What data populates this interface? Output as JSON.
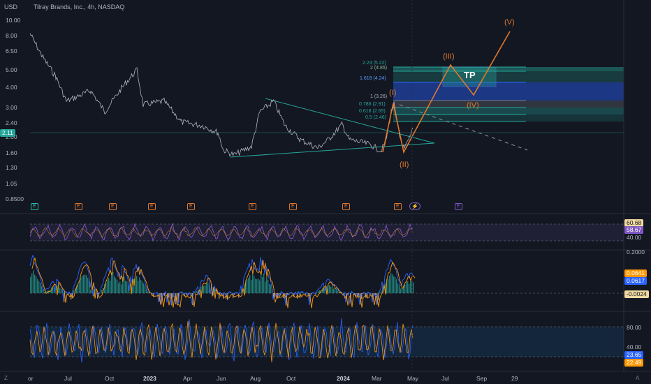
{
  "header": {
    "currency": "USD",
    "symbol": "Tilray Brands, Inc., 4h, NASDAQ"
  },
  "price_axis": [
    "10.00",
    "8.00",
    "6.50",
    "5.00",
    "4.00",
    "3.00",
    "2.40",
    "2.00",
    "1.60",
    "1.30",
    "1.05",
    "0.8500"
  ],
  "current_price": "2.11",
  "x_axis": [
    {
      "label": "or",
      "bold": false
    },
    {
      "label": "Jul",
      "bold": false
    },
    {
      "label": "Oct",
      "bold": false
    },
    {
      "label": "2023",
      "bold": true
    },
    {
      "label": "Apr",
      "bold": false
    },
    {
      "label": "Jun",
      "bold": false
    },
    {
      "label": "Aug",
      "bold": false
    },
    {
      "label": "Oct",
      "bold": false
    },
    {
      "label": "2024",
      "bold": true
    },
    {
      "label": "Mar",
      "bold": false
    },
    {
      "label": "May",
      "bold": false
    },
    {
      "label": "Jul",
      "bold": false
    },
    {
      "label": "Sep",
      "bold": false
    },
    {
      "label": "29",
      "bold": false
    }
  ],
  "waves": [
    "(I)",
    "(II)",
    "(III)",
    "(IV)",
    "(V)"
  ],
  "target_label": "TP",
  "fib_levels": [
    "2.23 (5.22)",
    "2 (4.85)",
    "1.618 (4.24)",
    "1 (3.26)",
    "0.786 (2.91)",
    "0.618 (2.65)",
    "0.5 (2.46)"
  ],
  "earnings_marker": "E",
  "dividend_marker": "⚡",
  "rsi": {
    "values": [
      "60.68",
      "58.67"
    ],
    "scale": [
      "40.00"
    ]
  },
  "macd": {
    "values": [
      "0.0641",
      "0.0617",
      "-0.0024"
    ],
    "scale": [
      "0.2000"
    ]
  },
  "stoch": {
    "values": [
      "23.65",
      "22.49"
    ],
    "scale": [
      "80.00",
      "40.00"
    ]
  },
  "corner_left": "Z",
  "corner_right": "A",
  "colors": {
    "background": "#131722",
    "price": "#b2b5be",
    "wave": "#e0782b",
    "triangle": "#26a69a",
    "fib_blue": "#2962ff",
    "fib_teal": "#26a69a",
    "rsi": "#7e57c2",
    "macd_blue": "#2962ff",
    "macd_orange": "#ff9800"
  }
}
